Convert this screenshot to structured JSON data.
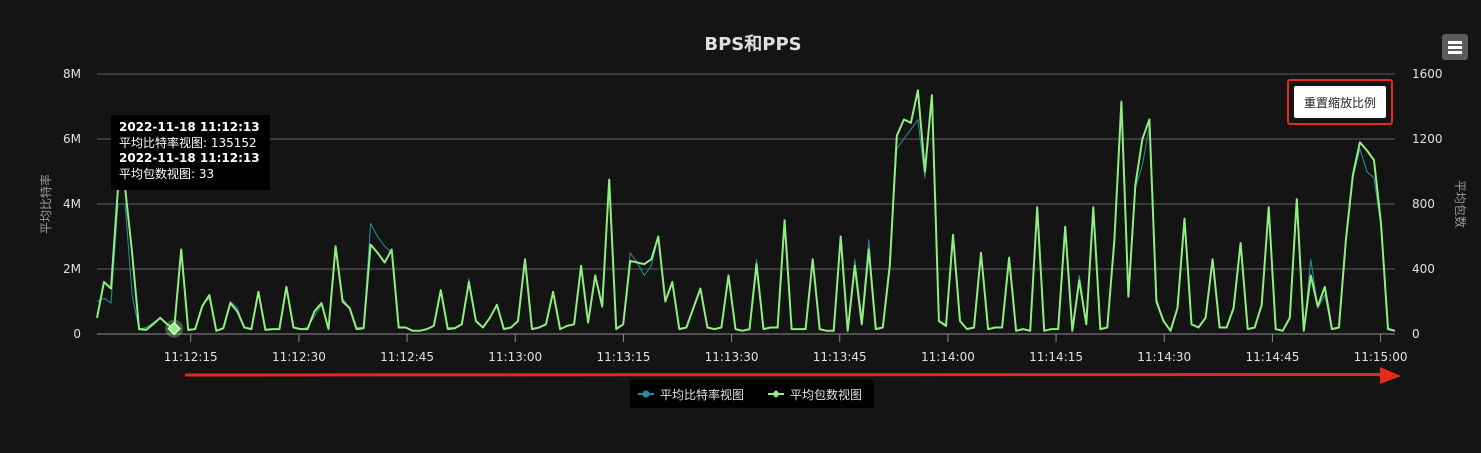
{
  "chart_data": {
    "type": "line",
    "title": "BPS和PPS",
    "ylabel_left": "平均比特率",
    "ylabel_right": "平均包数",
    "yticks_left": [
      "0",
      "2M",
      "4M",
      "6M",
      "8M"
    ],
    "yticks_right": [
      "0",
      "400",
      "800",
      "1200",
      "1600"
    ],
    "ylim_left": [
      0,
      8000000
    ],
    "ylim_right": [
      0,
      1600
    ],
    "xticks": [
      "11:12:15",
      "11:12:30",
      "11:12:45",
      "11:13:00",
      "11:13:15",
      "11:13:30",
      "11:13:45",
      "11:14:00",
      "11:14:15",
      "11:14:30",
      "11:14:45",
      "11:15:00"
    ],
    "xlim": [
      "11:12:02",
      "11:15:02"
    ],
    "grid": true,
    "legend_position": "bottom-center",
    "series": [
      {
        "name": "平均比特率视图",
        "color": "#2b8f95",
        "axis": "left",
        "values": [
          1000000,
          1100000,
          950000,
          4000000,
          4000000,
          1200000,
          150000,
          200000,
          350000,
          500000,
          300000,
          135152,
          2500000,
          100000,
          150000,
          900000,
          1100000,
          100000,
          200000,
          1000000,
          800000,
          200000,
          150000,
          1300000,
          120000,
          150000,
          150000,
          1400000,
          200000,
          150000,
          200000,
          550000,
          900000,
          150000,
          2600000,
          1100000,
          800000,
          200000,
          200000,
          3400000,
          3000000,
          2700000,
          2500000,
          200000,
          200000,
          100000,
          100000,
          150000,
          250000,
          1300000,
          200000,
          200000,
          300000,
          1700000,
          400000,
          200000,
          500000,
          900000,
          150000,
          200000,
          400000,
          2300000,
          150000,
          200000,
          300000,
          1300000,
          150000,
          250000,
          300000,
          2100000,
          400000,
          1800000,
          800000,
          4700000,
          200000,
          300000,
          2500000,
          2200000,
          1800000,
          2100000,
          3000000,
          1000000,
          1600000,
          150000,
          200000,
          800000,
          1400000,
          200000,
          150000,
          200000,
          1800000,
          150000,
          100000,
          150000,
          2300000,
          150000,
          200000,
          200000,
          3500000,
          150000,
          150000,
          150000,
          2300000,
          150000,
          100000,
          100000,
          3000000,
          100000,
          2300000,
          500000,
          2900000,
          150000,
          200000,
          2300000,
          5700000,
          6000000,
          6300000,
          6600000,
          4800000,
          7300000,
          400000,
          300000,
          3000000,
          400000,
          150000,
          200000,
          2500000,
          150000,
          200000,
          200000,
          2300000,
          100000,
          150000,
          100000,
          3800000,
          100000,
          150000,
          150000,
          3300000,
          100000,
          1800000,
          300000,
          3900000,
          150000,
          200000,
          3000000,
          7000000,
          1300000,
          4500000,
          5200000,
          6400000,
          1100000,
          400000,
          100000,
          800000,
          3500000,
          300000,
          200000,
          500000,
          2300000,
          200000,
          200000,
          800000,
          2800000,
          150000,
          200000,
          900000,
          3900000,
          150000,
          100000,
          500000,
          4000000,
          100000,
          2300000,
          800000,
          1200000,
          150000,
          200000,
          2800000,
          4800000,
          5700000,
          5000000,
          4800000,
          3300000,
          200000,
          100000
        ]
      },
      {
        "name": "平均包数视图",
        "color": "#90ee7e",
        "axis": "right",
        "values": [
          100,
          320,
          280,
          900,
          900,
          500,
          30,
          25,
          60,
          100,
          60,
          33,
          520,
          25,
          30,
          170,
          240,
          20,
          35,
          190,
          140,
          40,
          30,
          260,
          25,
          30,
          30,
          290,
          40,
          30,
          30,
          140,
          190,
          30,
          540,
          200,
          160,
          30,
          35,
          550,
          500,
          440,
          520,
          40,
          40,
          20,
          20,
          30,
          50,
          270,
          30,
          35,
          60,
          320,
          80,
          40,
          100,
          180,
          30,
          40,
          80,
          460,
          30,
          40,
          60,
          260,
          30,
          50,
          60,
          420,
          70,
          360,
          170,
          950,
          30,
          60,
          450,
          440,
          430,
          460,
          600,
          200,
          320,
          30,
          40,
          160,
          280,
          40,
          30,
          40,
          360,
          30,
          20,
          30,
          430,
          30,
          40,
          40,
          700,
          30,
          30,
          30,
          460,
          30,
          20,
          20,
          600,
          20,
          420,
          60,
          520,
          30,
          40,
          420,
          1220,
          1320,
          1300,
          1500,
          1000,
          1470,
          80,
          50,
          610,
          80,
          30,
          40,
          500,
          30,
          40,
          40,
          470,
          20,
          30,
          20,
          780,
          20,
          30,
          30,
          660,
          20,
          330,
          60,
          780,
          30,
          40,
          580,
          1430,
          230,
          920,
          1200,
          1320,
          200,
          80,
          20,
          160,
          710,
          60,
          40,
          100,
          460,
          40,
          40,
          160,
          560,
          30,
          40,
          180,
          780,
          30,
          20,
          100,
          830,
          20,
          360,
          170,
          290,
          30,
          40,
          580,
          980,
          1180,
          1130,
          1070,
          680,
          30,
          20
        ]
      }
    ]
  },
  "tooltip": {
    "line1": "2022-11-18 11:12:13",
    "line2": "平均比特率视图: 135152",
    "line3": "2022-11-18 11:12:13",
    "line4": "平均包数视图: 33"
  },
  "toolbar": {
    "reset_zoom_label": "重置缩放比例",
    "menu_icon": "hamburger-menu-icon"
  },
  "colors": {
    "background": "#141414",
    "gridline": "#707070",
    "annotation_red": "#e52a1c"
  }
}
